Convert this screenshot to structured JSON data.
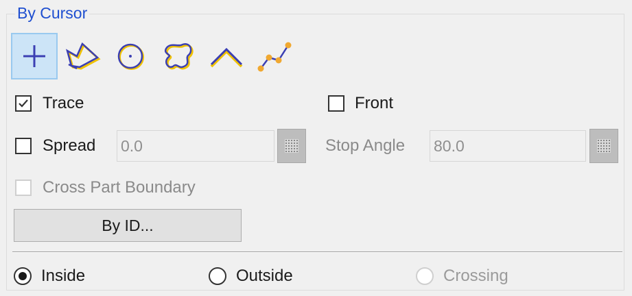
{
  "group": {
    "title": "By Cursor"
  },
  "tools": [
    {
      "name": "single-select-icon",
      "selected": true
    },
    {
      "name": "polygon-select-icon",
      "selected": false
    },
    {
      "name": "circle-select-icon",
      "selected": false
    },
    {
      "name": "freehand-select-icon",
      "selected": false
    },
    {
      "name": "polyline-select-icon",
      "selected": false
    },
    {
      "name": "path-select-icon",
      "selected": false
    }
  ],
  "options": {
    "trace": {
      "label": "Trace",
      "checked": true
    },
    "front": {
      "label": "Front",
      "checked": false
    },
    "spread": {
      "label": "Spread",
      "checked": false,
      "value": "0.0"
    },
    "stop_angle": {
      "label": "Stop Angle",
      "value": "80.0"
    },
    "cross_part_boundary": {
      "label": "Cross Part Boundary",
      "checked": false,
      "enabled": false
    }
  },
  "by_id_button": {
    "label": "By ID..."
  },
  "selection_mode": {
    "inside": {
      "label": "Inside",
      "selected": true
    },
    "outside": {
      "label": "Outside",
      "selected": false
    },
    "crossing": {
      "label": "Crossing",
      "selected": false,
      "enabled": false
    }
  },
  "colors": {
    "title": "#1f4fd0",
    "icon_blue": "#3b3fb3",
    "icon_yellow": "#f0c200",
    "icon_orange": "#f0a830"
  }
}
